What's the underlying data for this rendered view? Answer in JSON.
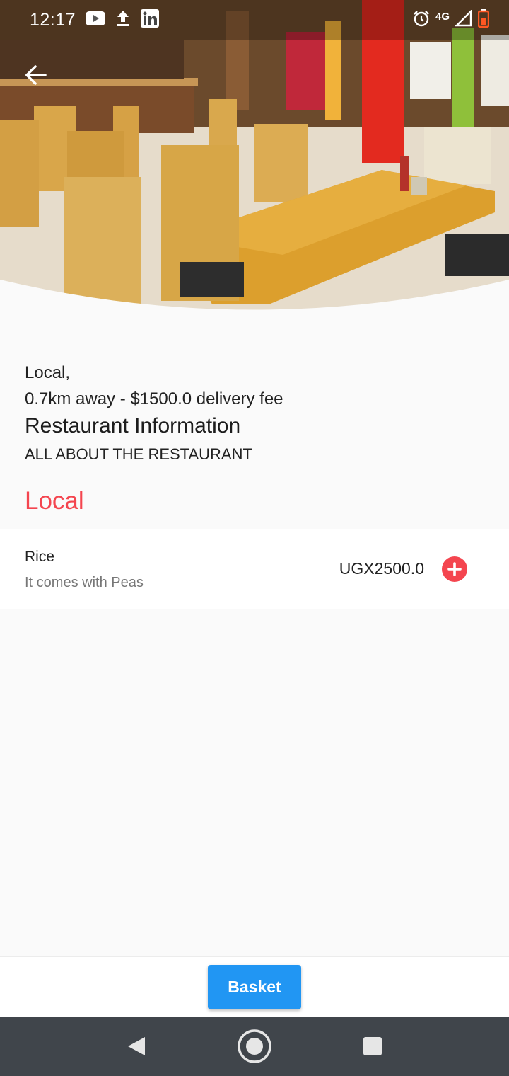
{
  "status_bar": {
    "time": "12:17",
    "network": "4G",
    "icons": [
      "youtube-icon",
      "upload-icon",
      "linkedin-icon",
      "alarm-icon",
      "signal-icon",
      "battery-icon"
    ]
  },
  "restaurant": {
    "category_line": "Local,",
    "distance_line": "0.7km away - $1500.0 delivery fee",
    "info_title": "Restaurant Information",
    "info_subtitle": "ALL ABOUT THE RESTAURANT"
  },
  "menu": {
    "section_title": "Local",
    "items": [
      {
        "name": "Rice",
        "description": "It comes with Peas",
        "price": "UGX2500.0"
      }
    ]
  },
  "footer": {
    "basket_label": "Basket"
  },
  "colors": {
    "accent": "#f4454f",
    "primary_button": "#2196f3",
    "nav_bar": "#40454b"
  }
}
